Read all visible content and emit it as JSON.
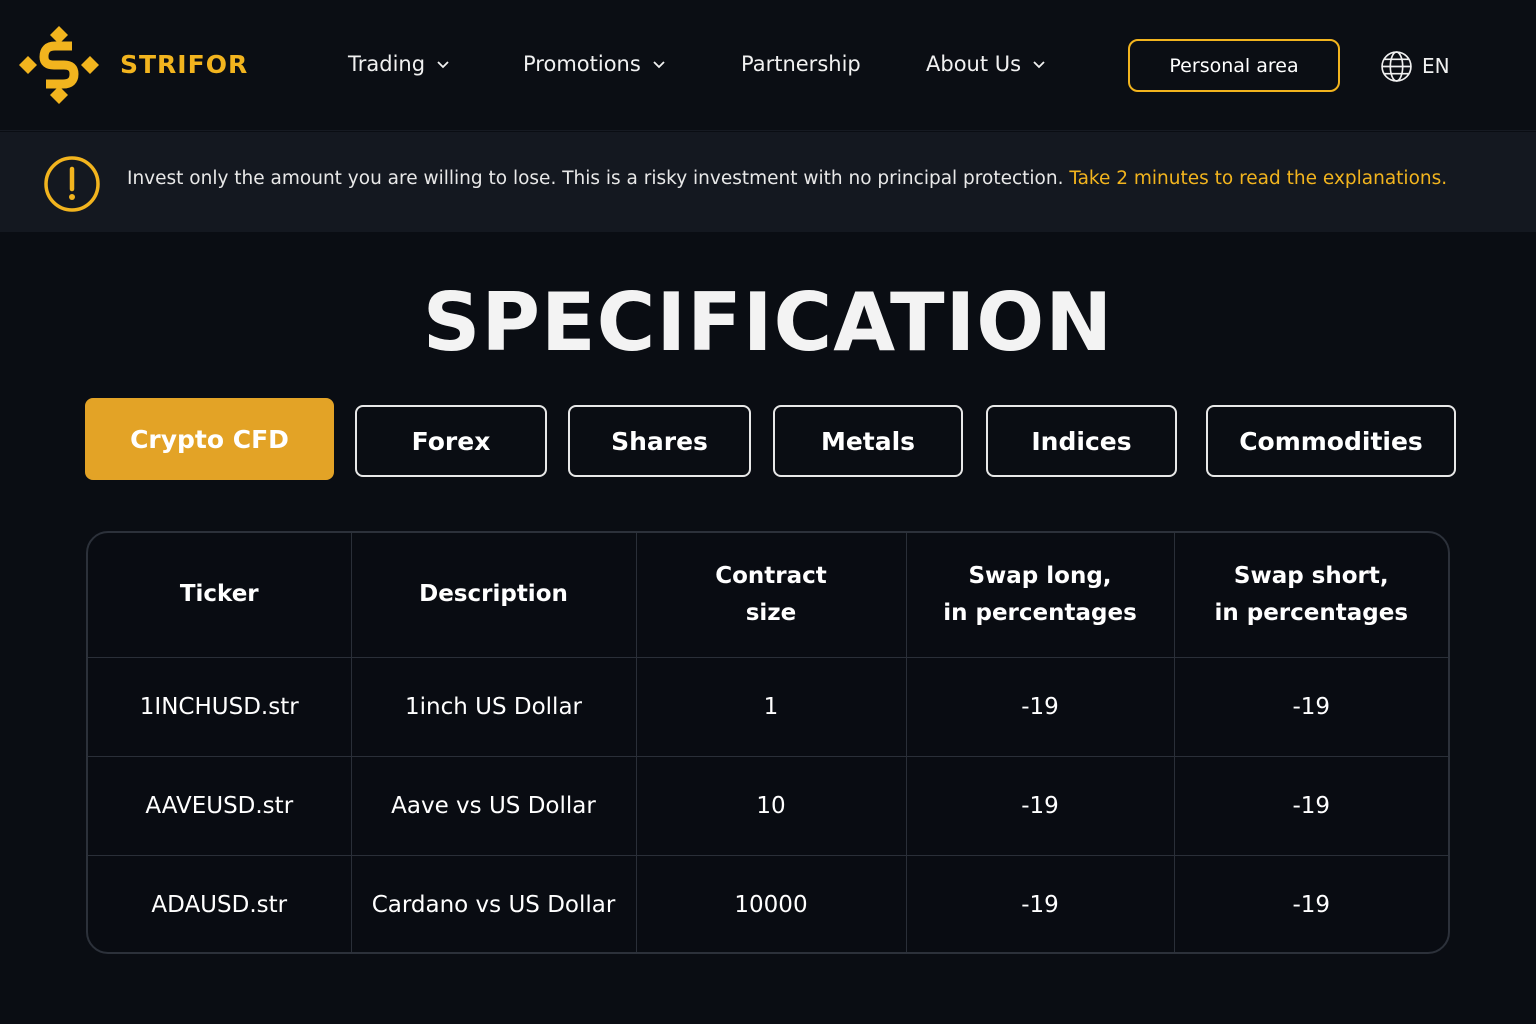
{
  "header": {
    "brand": "STRIFOR",
    "nav": [
      {
        "label": "Trading",
        "has_dropdown": true
      },
      {
        "label": "Promotions",
        "has_dropdown": true
      },
      {
        "label": "Partnership",
        "has_dropdown": false
      },
      {
        "label": "About Us",
        "has_dropdown": true
      }
    ],
    "personal_area_label": "Personal area",
    "language": "EN",
    "icons": {
      "language": "globe-icon",
      "dropdown": "chevron-down-icon"
    }
  },
  "warning": {
    "icon": "exclamation-circle-icon",
    "text": "Invest only the amount you are willing to lose. This is a risky investment with no  principal protection.",
    "link_text": "Take 2 minutes to read the explanations."
  },
  "main": {
    "title": "SPECIFICATION",
    "tabs": [
      {
        "label": "Crypto CFD",
        "active": true
      },
      {
        "label": "Forex",
        "active": false
      },
      {
        "label": "Shares",
        "active": false
      },
      {
        "label": "Metals",
        "active": false
      },
      {
        "label": "Indices",
        "active": false
      },
      {
        "label": "Commodities",
        "active": false
      }
    ],
    "table": {
      "headers": [
        {
          "line1": "Ticker",
          "line2": ""
        },
        {
          "line1": "Description",
          "line2": ""
        },
        {
          "line1": "Contract",
          "line2": "size"
        },
        {
          "line1": "Swap long,",
          "line2": "in percentages"
        },
        {
          "line1": "Swap short,",
          "line2": "in percentages"
        }
      ],
      "rows": [
        [
          "1INCHUSD.str",
          "1inch US Dollar",
          "1",
          "-19",
          "-19"
        ],
        [
          "AAVEUSD.str",
          "Aave vs US Dollar",
          "10",
          "-19",
          "-19"
        ],
        [
          "ADAUSD.str",
          "Cardano vs US Dollar",
          "10000",
          "-19",
          "-19"
        ]
      ]
    }
  },
  "colors": {
    "accent": "#f2b41e",
    "active_tab": "#e3a326",
    "background": "#0a0d13",
    "warning_bg": "#141820"
  }
}
